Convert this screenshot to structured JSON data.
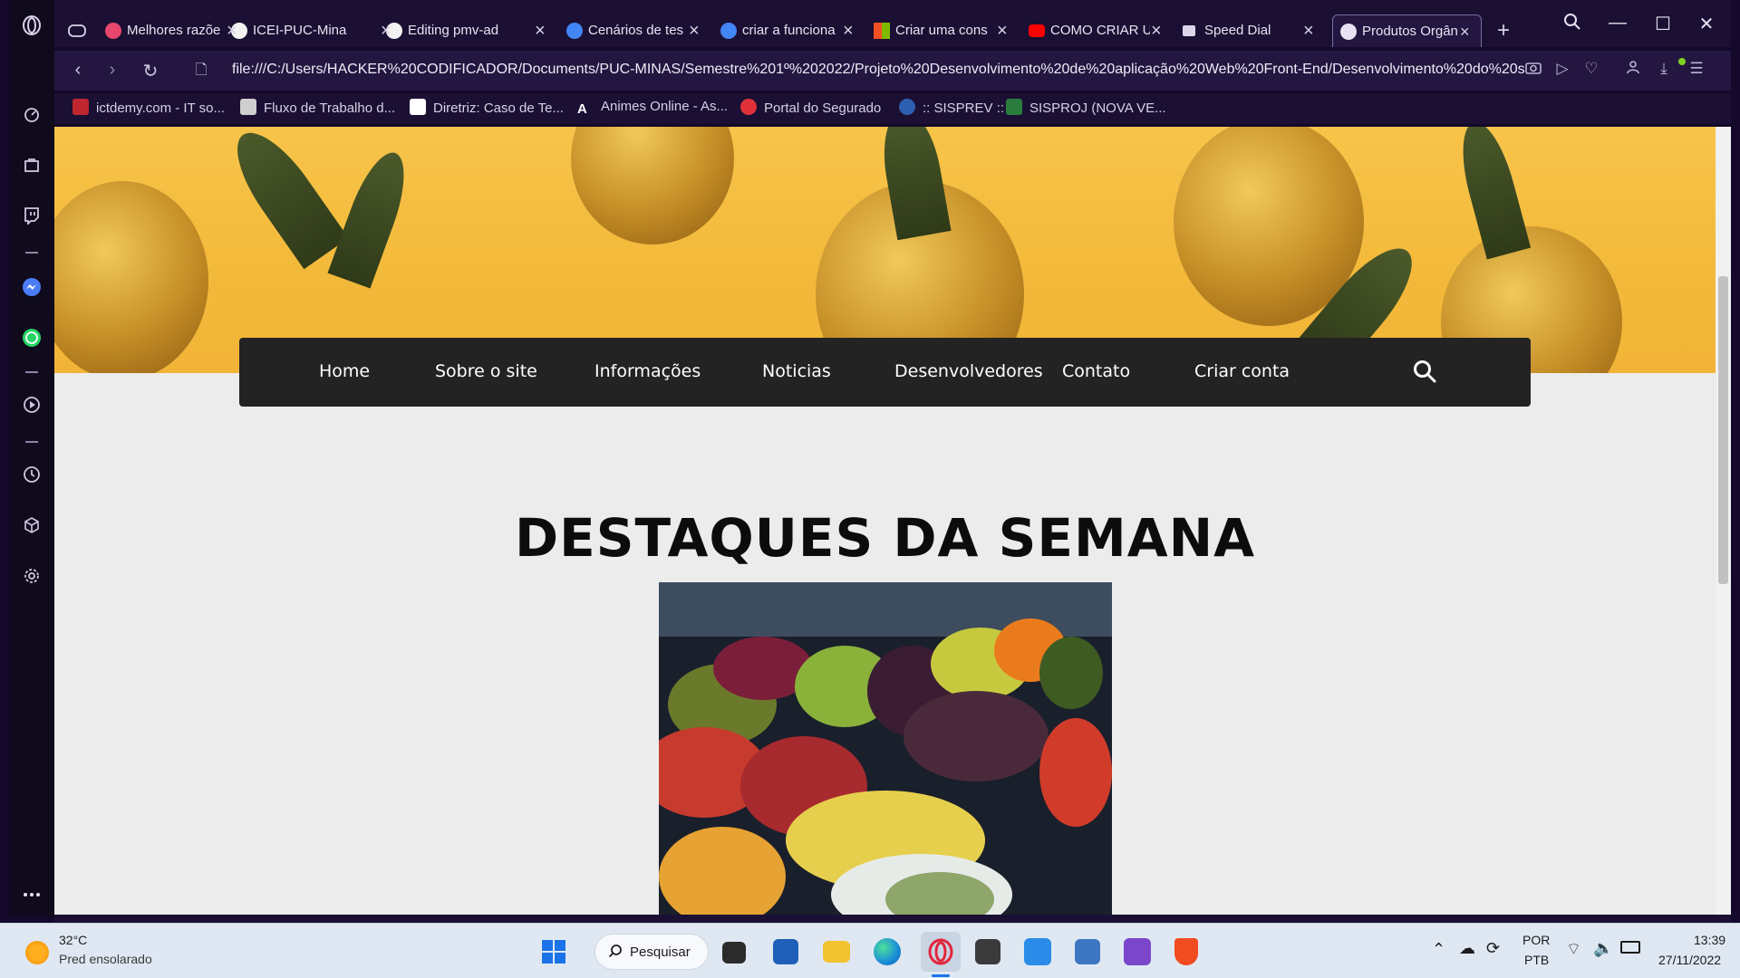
{
  "browser": {
    "tabs": [
      {
        "title": "Melhores razõe",
        "icon": "s-favicon-icon"
      },
      {
        "title": "ICEI-PUC-Mina",
        "icon": "github-icon"
      },
      {
        "title": "Editing pmv-ad",
        "icon": "github-icon"
      },
      {
        "title": "Cenários de tes",
        "icon": "google-icon"
      },
      {
        "title": "criar a funciona",
        "icon": "google-icon"
      },
      {
        "title": "Criar uma cons",
        "icon": "microsoft-icon"
      },
      {
        "title": "COMO CRIAR U",
        "icon": "youtube-icon"
      },
      {
        "title": "Speed Dial",
        "icon": "speed-dial-icon"
      },
      {
        "title": "Produtos Orgân",
        "icon": "globe-icon",
        "active": true
      }
    ],
    "url": "file:///C:/Users/HACKER%20CODIFICADOR/Documents/PUC-MINAS/Semestre%201º%202022/Projeto%20Desenvolvimento%20de%20aplicação%20Web%20Front-End/Desenvolvimento%20do%20s",
    "bookmarks": [
      {
        "label": "ictdemy.com - IT so...",
        "color": "#c0262f"
      },
      {
        "label": "Fluxo de Trabalho d...",
        "color": "#cfcfcf"
      },
      {
        "label": "Diretriz: Caso de Te...",
        "color": "#ffffff"
      },
      {
        "label": "Animes Online - As...",
        "color": "#ffffff"
      },
      {
        "label": "Portal do Segurado",
        "color": "#e0313a"
      },
      {
        "label": ":: SISPREV ::",
        "color": "#2d5fb0"
      },
      {
        "label": "SISPROJ (NOVA VE...",
        "color": "#2a7c3c"
      }
    ]
  },
  "page": {
    "menu": [
      "Home",
      "Sobre o site",
      "Informações",
      "Noticias",
      "Desenvolvedores",
      "Contato",
      "Criar conta"
    ],
    "headline": "DESTAQUES DA SEMANA"
  },
  "taskbar": {
    "weather_temp": "32°C",
    "weather_desc": "Pred ensolarado",
    "search_label": "Pesquisar",
    "lang_top": "POR",
    "lang_bottom": "PTB",
    "time": "13:39",
    "date": "27/11/2022"
  },
  "colors": {
    "menu_bg": "#232323",
    "page_bg": "#ececec",
    "banner_yellow": "#f3b93a",
    "browser_bg": "#1b0f33"
  }
}
